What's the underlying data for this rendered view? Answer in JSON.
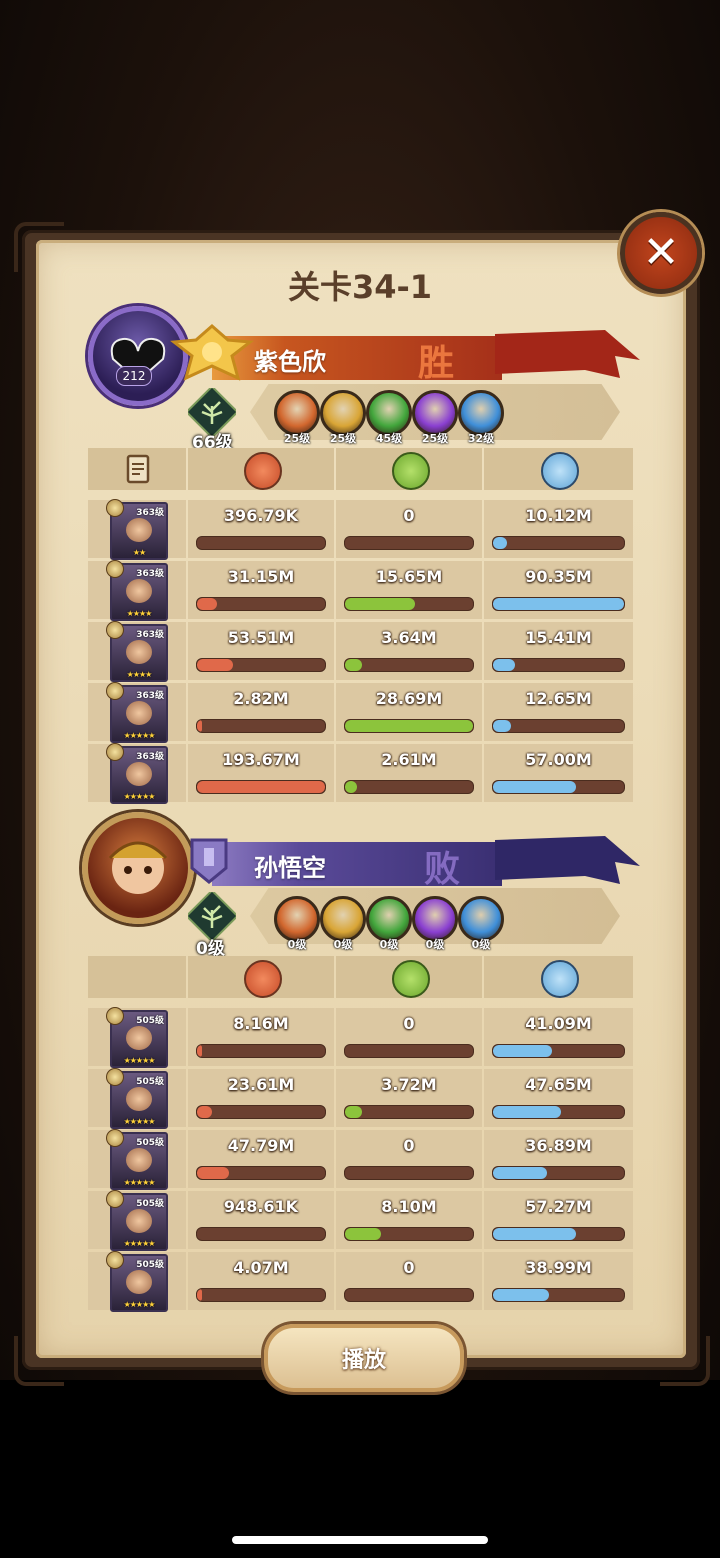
{
  "title": "关卡34-1",
  "actions": {
    "play_label": "播放",
    "close_icon": "close-icon"
  },
  "colors": {
    "damage": "#e0694a",
    "heal": "#8cc43c",
    "tank": "#7cc0ec",
    "bar_bg": "#6b4030"
  },
  "teams": [
    {
      "name": "紫色欣",
      "result": "胜",
      "avatar_level": "212",
      "tree_level": "66级",
      "factions": [
        {
          "icon": "lightbearer-icon",
          "color": "#d2672e",
          "level": "25级"
        },
        {
          "icon": "mauler-icon",
          "color": "#d9a535",
          "level": "25级"
        },
        {
          "icon": "wilder-icon",
          "color": "#42a63c",
          "level": "45级"
        },
        {
          "icon": "graveborn-icon",
          "color": "#8a3fd1",
          "level": "25级"
        },
        {
          "icon": "celestial-icon",
          "color": "#3f8fd9",
          "level": "32级"
        }
      ],
      "heroes": [
        {
          "level": "363级",
          "stars": "★★",
          "damage": "396.79K",
          "heal": "0",
          "tank": "10.12M",
          "damage_pct": 0.0,
          "heal_pct": 0.0,
          "tank_pct": 0.11
        },
        {
          "level": "363级",
          "stars": "★★★★",
          "damage": "31.15M",
          "heal": "15.65M",
          "tank": "90.35M",
          "damage_pct": 0.16,
          "heal_pct": 0.55,
          "tank_pct": 1.0
        },
        {
          "level": "363级",
          "stars": "★★★★",
          "damage": "53.51M",
          "heal": "3.64M",
          "tank": "15.41M",
          "damage_pct": 0.28,
          "heal_pct": 0.13,
          "tank_pct": 0.17
        },
        {
          "level": "363级",
          "stars": "★★★★★",
          "damage": "2.82M",
          "heal": "28.69M",
          "tank": "12.65M",
          "damage_pct": 0.01,
          "heal_pct": 1.0,
          "tank_pct": 0.14
        },
        {
          "level": "363级",
          "stars": "★★★★★",
          "damage": "193.67M",
          "heal": "2.61M",
          "tank": "57.00M",
          "damage_pct": 1.0,
          "heal_pct": 0.09,
          "tank_pct": 0.63
        }
      ]
    },
    {
      "name": "孙悟空",
      "result": "败",
      "tree_level": "0级",
      "factions": [
        {
          "icon": "lightbearer-icon",
          "color": "#d2672e",
          "level": "0级"
        },
        {
          "icon": "mauler-icon",
          "color": "#d9a535",
          "level": "0级"
        },
        {
          "icon": "wilder-icon",
          "color": "#42a63c",
          "level": "0级"
        },
        {
          "icon": "graveborn-icon",
          "color": "#8a3fd1",
          "level": "0级"
        },
        {
          "icon": "celestial-icon",
          "color": "#3f8fd9",
          "level": "0级"
        }
      ],
      "heroes": [
        {
          "level": "505级",
          "stars": "★★★★★",
          "damage": "8.16M",
          "heal": "0",
          "tank": "41.09M",
          "damage_pct": 0.04,
          "heal_pct": 0.0,
          "tank_pct": 0.45
        },
        {
          "level": "505级",
          "stars": "★★★★★",
          "damage": "23.61M",
          "heal": "3.72M",
          "tank": "47.65M",
          "damage_pct": 0.12,
          "heal_pct": 0.13,
          "tank_pct": 0.52
        },
        {
          "level": "505级",
          "stars": "★★★★★",
          "damage": "47.79M",
          "heal": "0",
          "tank": "36.89M",
          "damage_pct": 0.25,
          "heal_pct": 0.0,
          "tank_pct": 0.41
        },
        {
          "level": "505级",
          "stars": "★★★★★",
          "damage": "948.61K",
          "heal": "8.10M",
          "tank": "57.27M",
          "damage_pct": 0.0,
          "heal_pct": 0.28,
          "tank_pct": 0.63
        },
        {
          "level": "505级",
          "stars": "★★★★★",
          "damage": "4.07M",
          "heal": "0",
          "tank": "38.99M",
          "damage_pct": 0.02,
          "heal_pct": 0.0,
          "tank_pct": 0.43
        }
      ]
    }
  ]
}
